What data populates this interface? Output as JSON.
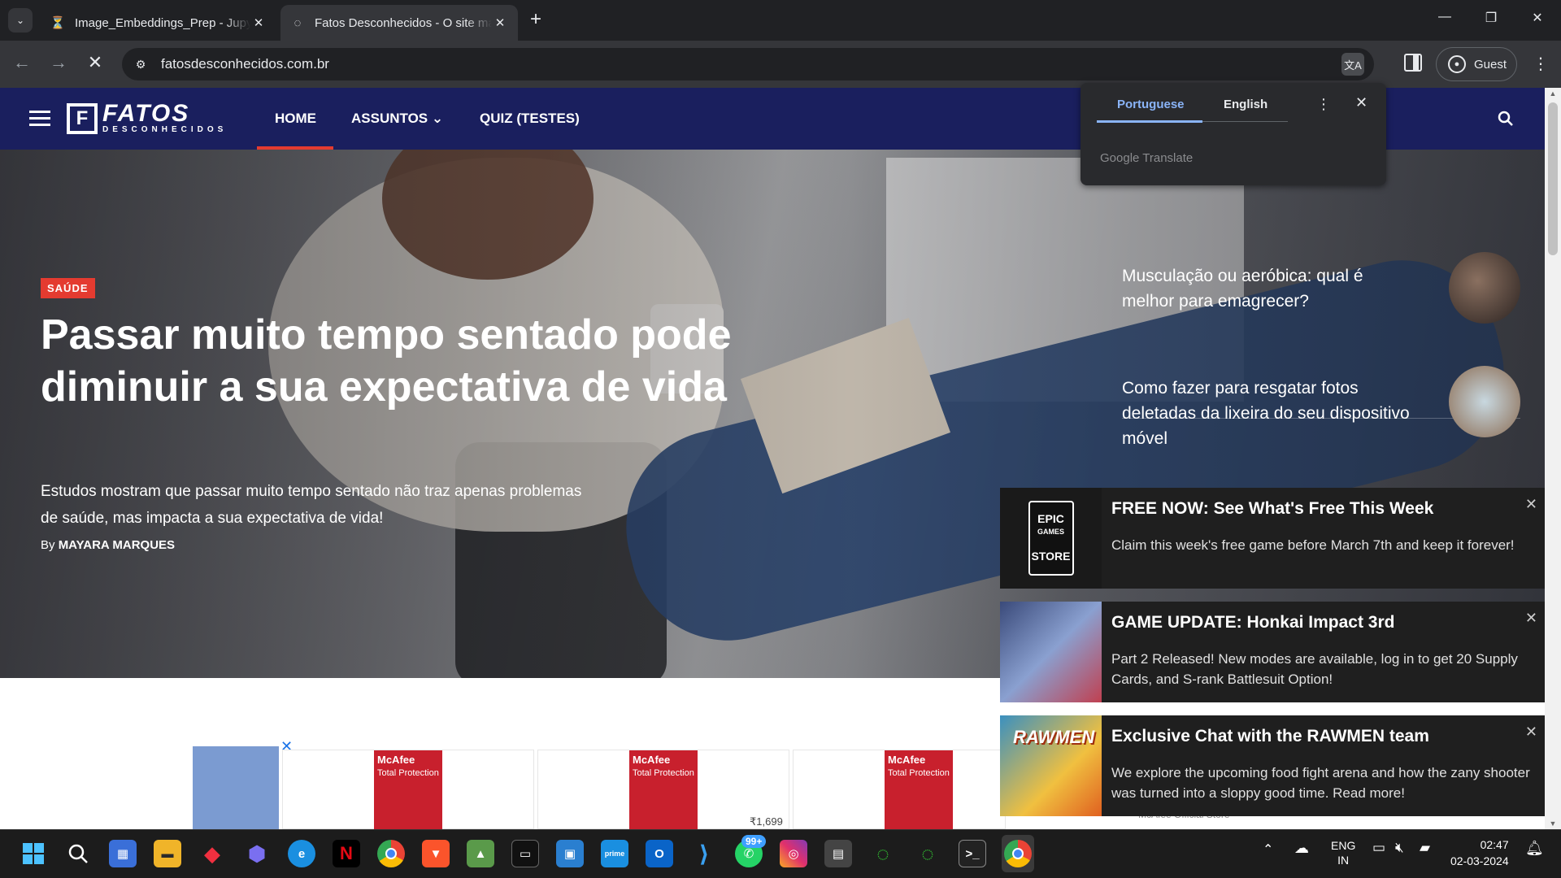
{
  "browser": {
    "tabs": [
      {
        "title": "Image_Embeddings_Prep - Jupyter",
        "icon": "jupyter-hourglass-icon",
        "close": "✕"
      },
      {
        "title": "Fatos Desconhecidos - O site mais curioso",
        "icon": "loading-globe-icon",
        "close": "✕"
      }
    ],
    "new_tab": "+",
    "window_controls": {
      "minimize": "—",
      "restore": "❐",
      "close": "✕"
    },
    "url": "fatosdesconhecidos.com.br",
    "profile_label": "Guest",
    "translate_popup": {
      "lang_source": "Portuguese",
      "lang_target": "English",
      "provider": "Google Translate"
    }
  },
  "site": {
    "logo_main": "FATOS",
    "logo_sub": "DESCONHECIDOS",
    "nav": {
      "home": "HOME",
      "assuntos": "ASSUNTOS",
      "quiz": "QUIZ (TESTES)"
    },
    "hero": {
      "category": "SAÚDE",
      "headline": "Passar muito tempo sentado pode diminuir a sua expectativa de vida",
      "dek": "Estudos mostram que passar muito tempo sentado não traz apenas problemas de saúde, mas impacta a sua expectativa de vida!",
      "by_prefix": "By",
      "author": "MAYARA MARQUES"
    },
    "related": [
      {
        "title": "Musculação ou aeróbica: qual é melhor para emagrecer?"
      },
      {
        "title": "Como fazer para resgatar fotos deletadas da lixeira do seu dispositivo móvel"
      }
    ],
    "ad": {
      "brand": "McAfee",
      "product": "Total Protection",
      "price": "₹1,699",
      "footer": "McAfee Official Store",
      "close": "✕"
    }
  },
  "notifications": [
    {
      "title": "FREE NOW: See What's Free This Week",
      "body": "Claim this week's free game before March 7th and keep it forever!",
      "image_label_1": "EPIC",
      "image_label_2": "GAMES",
      "image_label_3": "STORE"
    },
    {
      "title": "GAME UPDATE: Honkai Impact 3rd",
      "body": "Part 2 Released! New modes are available, log in to get 20 Supply Cards, and S-rank Battlesuit Option!"
    },
    {
      "title": "Exclusive Chat with the RAWMEN team",
      "body": "We explore the upcoming food fight arena and how the zany shooter was turned into a sloppy good time. Read more!",
      "image_label": "RAWMEN"
    }
  ],
  "taskbar": {
    "whatsapp_badge": "99+",
    "lang_line1": "ENG",
    "lang_line2": "IN",
    "time": "02:47",
    "date": "02-03-2024"
  },
  "colors": {
    "site_nav": "#1a1f5e",
    "accent_red": "#e43b30",
    "translate_blue": "#8ab4f8"
  }
}
